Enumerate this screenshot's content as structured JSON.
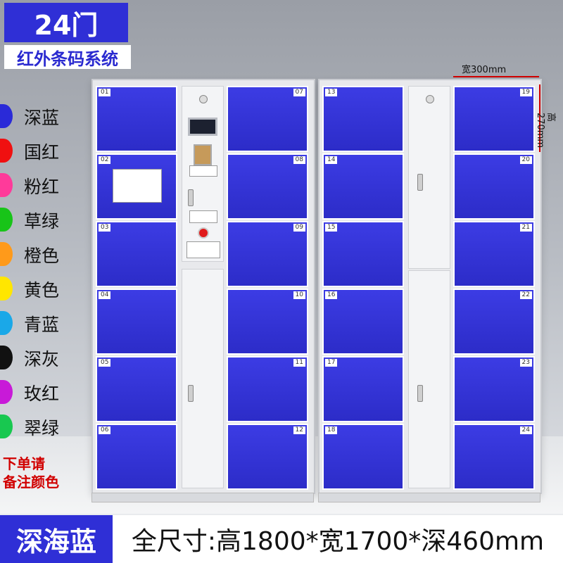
{
  "header": {
    "title": "24门",
    "subtitle": "红外条码系统"
  },
  "colors": [
    {
      "label": "深蓝",
      "hex": "#2a2ad8"
    },
    {
      "label": "国红",
      "hex": "#f01010"
    },
    {
      "label": "粉红",
      "hex": "#ff3a9a"
    },
    {
      "label": "草绿",
      "hex": "#18c418"
    },
    {
      "label": "橙色",
      "hex": "#ff9a1a"
    },
    {
      "label": "黄色",
      "hex": "#ffe600"
    },
    {
      "label": "青蓝",
      "hex": "#1aa8e8"
    },
    {
      "label": "深灰",
      "hex": "#111111"
    },
    {
      "label": "玫红",
      "hex": "#c81ad8"
    },
    {
      "label": "翠绿",
      "hex": "#18c850"
    }
  ],
  "note": {
    "line1": "下单请",
    "line2": "备注颜色"
  },
  "dimensions": {
    "width_label": "宽300mm",
    "height_label": "高270mm"
  },
  "doors": {
    "left_col1": [
      "01",
      "02",
      "03",
      "04",
      "05",
      "06"
    ],
    "left_col2": [
      "07",
      "08",
      "09",
      "10",
      "11",
      "12"
    ],
    "right_col1": [
      "13",
      "14",
      "15",
      "16",
      "17",
      "18"
    ],
    "right_col2": [
      "19",
      "20",
      "21",
      "22",
      "23",
      "24"
    ]
  },
  "footer": {
    "color_name": "深海蓝",
    "size_text": "全尺寸:高1800*宽1700*深460mm"
  }
}
